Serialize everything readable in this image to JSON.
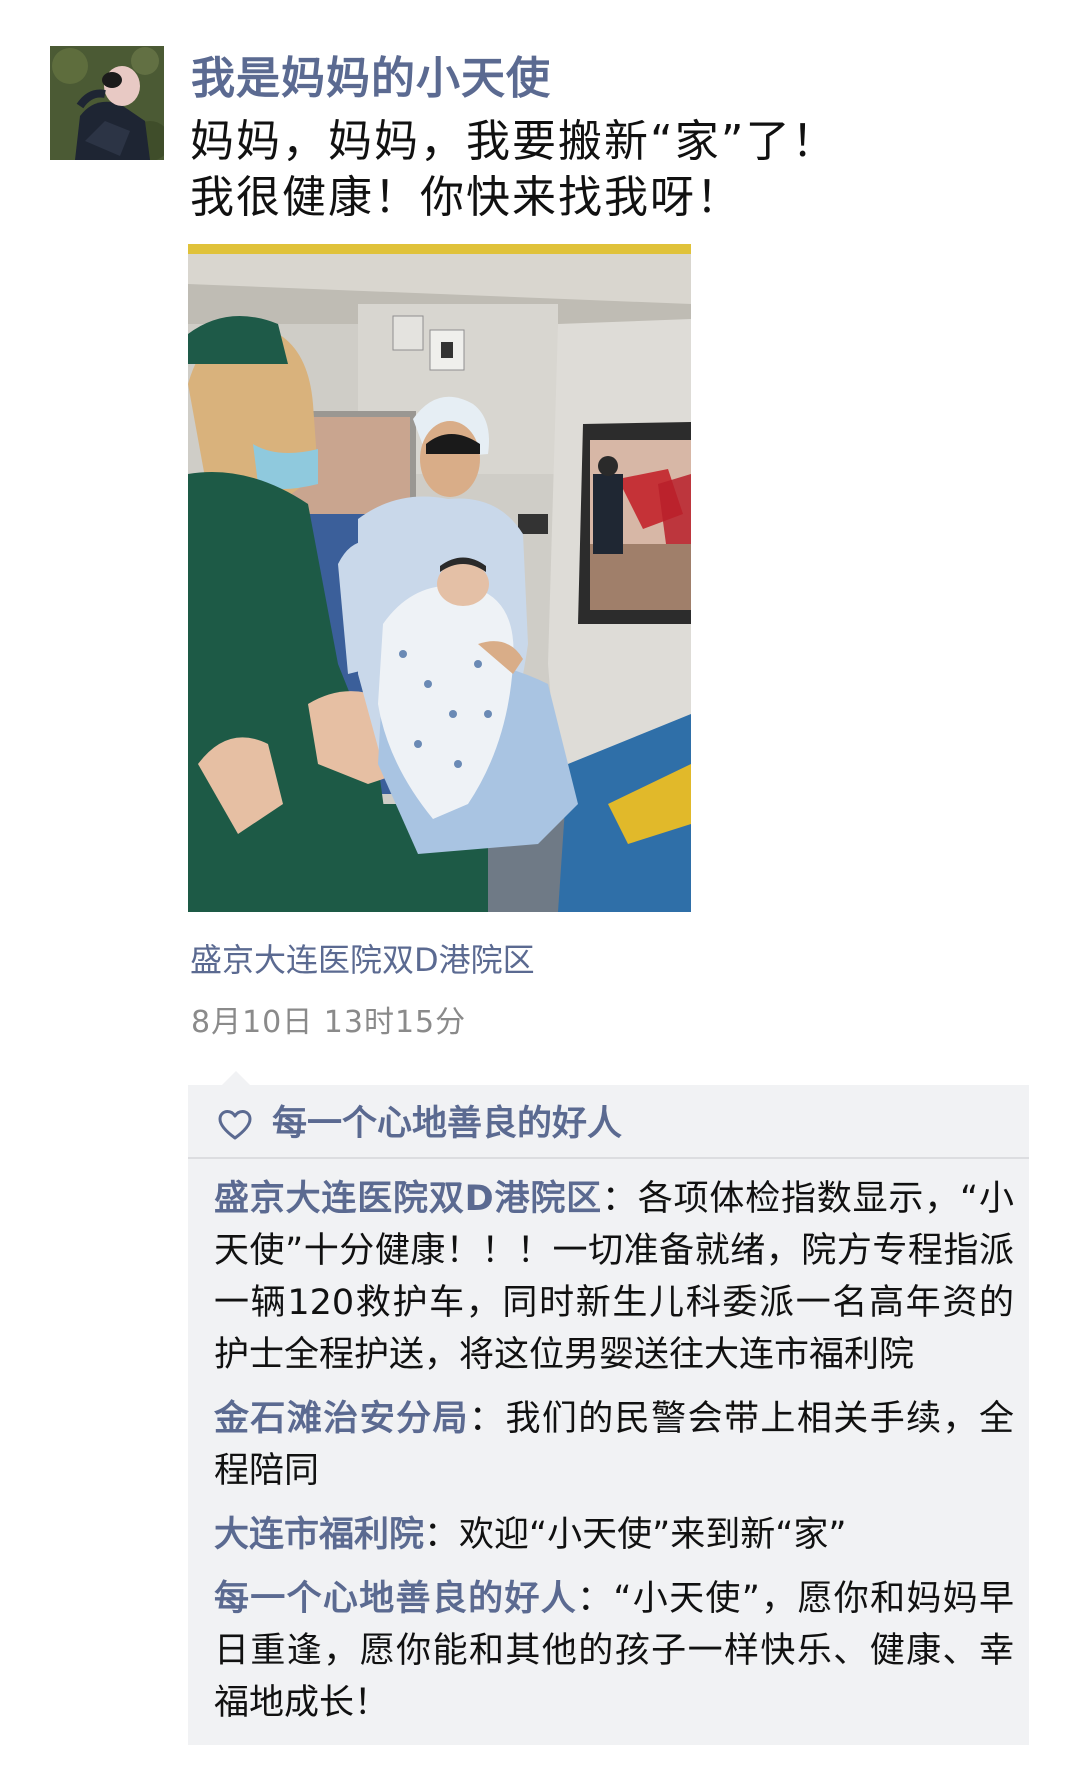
{
  "post": {
    "author": "我是妈妈的小天使",
    "text_lines": [
      "妈妈，妈妈，我要搬新“家”了！",
      "我很健康！你快来找我呀！"
    ],
    "location": "盛京大连医院双D港院区",
    "timestamp": "8月10日  13时15分"
  },
  "likes": {
    "icon": "heart-outline-icon",
    "names": "每一个心地善良的好人"
  },
  "comments": [
    {
      "name": "盛京大连医院双D港院区",
      "separator": "：",
      "text": "各项体检指数显示，“小天使”十分健康！！！一切准备就绪，院方专程指派一辆120救护车，同时新生儿科委派一名高年资的护士全程护送，将这位男婴送往大连市福利院"
    },
    {
      "name": "金石滩治安分局",
      "separator": "：",
      "text": "我们的民警会带上相关手续，全程陪同"
    },
    {
      "name": "大连市福利院",
      "separator": "：",
      "text": "欢迎“小天使”来到新“家”"
    },
    {
      "name": "每一个心地善良的好人",
      "separator": "：",
      "text": "“小天使”，愿你和妈妈早日重逢，愿你能和其他的孩子一样快乐、健康、幸福地成长！"
    }
  ],
  "colors": {
    "name_link": "#5b6a91",
    "panel_bg": "#f1f2f4",
    "timestamp": "#8a8a8a"
  }
}
